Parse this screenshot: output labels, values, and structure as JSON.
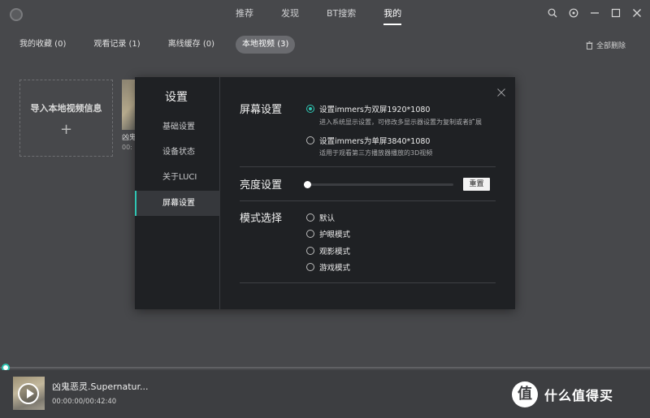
{
  "nav": {
    "tabs": [
      {
        "label": "推荐",
        "active": false
      },
      {
        "label": "发现",
        "active": false
      },
      {
        "label": "BT搜索",
        "active": false
      },
      {
        "label": "我的",
        "active": true
      }
    ]
  },
  "window": {
    "icons": [
      "search-icon",
      "record-icon",
      "minimize-icon",
      "maximize-icon",
      "close-icon"
    ]
  },
  "categories": {
    "tabs": [
      {
        "label": "我的收藏 (0)",
        "active": false
      },
      {
        "label": "观看记录 (1)",
        "active": false
      },
      {
        "label": "离线缓存 (0)",
        "active": false
      },
      {
        "label": "本地视频 (3)",
        "active": true
      }
    ],
    "clear_all": "全部删除"
  },
  "import": {
    "label": "导入本地视频信息",
    "plus": "+"
  },
  "video_card": {
    "title": "凶鬼",
    "time": "00:"
  },
  "settings": {
    "title": "设置",
    "side_items": [
      {
        "label": "基础设置",
        "active": false
      },
      {
        "label": "设备状态",
        "active": false
      },
      {
        "label": "关于LUCI",
        "active": false
      },
      {
        "label": "屏幕设置",
        "active": true
      }
    ],
    "screen": {
      "label": "屏幕设置",
      "options": [
        {
          "label": "设置immers为双屏1920*1080",
          "desc": "进入系统显示设置，可修改多显示器设置为复制或者扩展",
          "checked": true
        },
        {
          "label": "设置immers为单屏3840*1080",
          "desc": "适用于观看第三方播放器播放的3D视频",
          "checked": false
        }
      ]
    },
    "brightness": {
      "label": "亮度设置",
      "level": 0.02,
      "reset_label": "重置"
    },
    "mode": {
      "label": "模式选择",
      "options": [
        {
          "label": "默认",
          "checked": false
        },
        {
          "label": "护眼模式",
          "checked": false
        },
        {
          "label": "观影模式",
          "checked": false
        },
        {
          "label": "游戏模式",
          "checked": false
        }
      ]
    }
  },
  "player": {
    "title": "凶鬼恶灵.Supernatur...",
    "time": "00:00:00/00:42:40",
    "progress": 0.0
  },
  "watermark": {
    "text": "什么值得买"
  },
  "colors": {
    "accent": "#2fc6b3",
    "background": "#47484b",
    "dialog": "#1f2124"
  }
}
